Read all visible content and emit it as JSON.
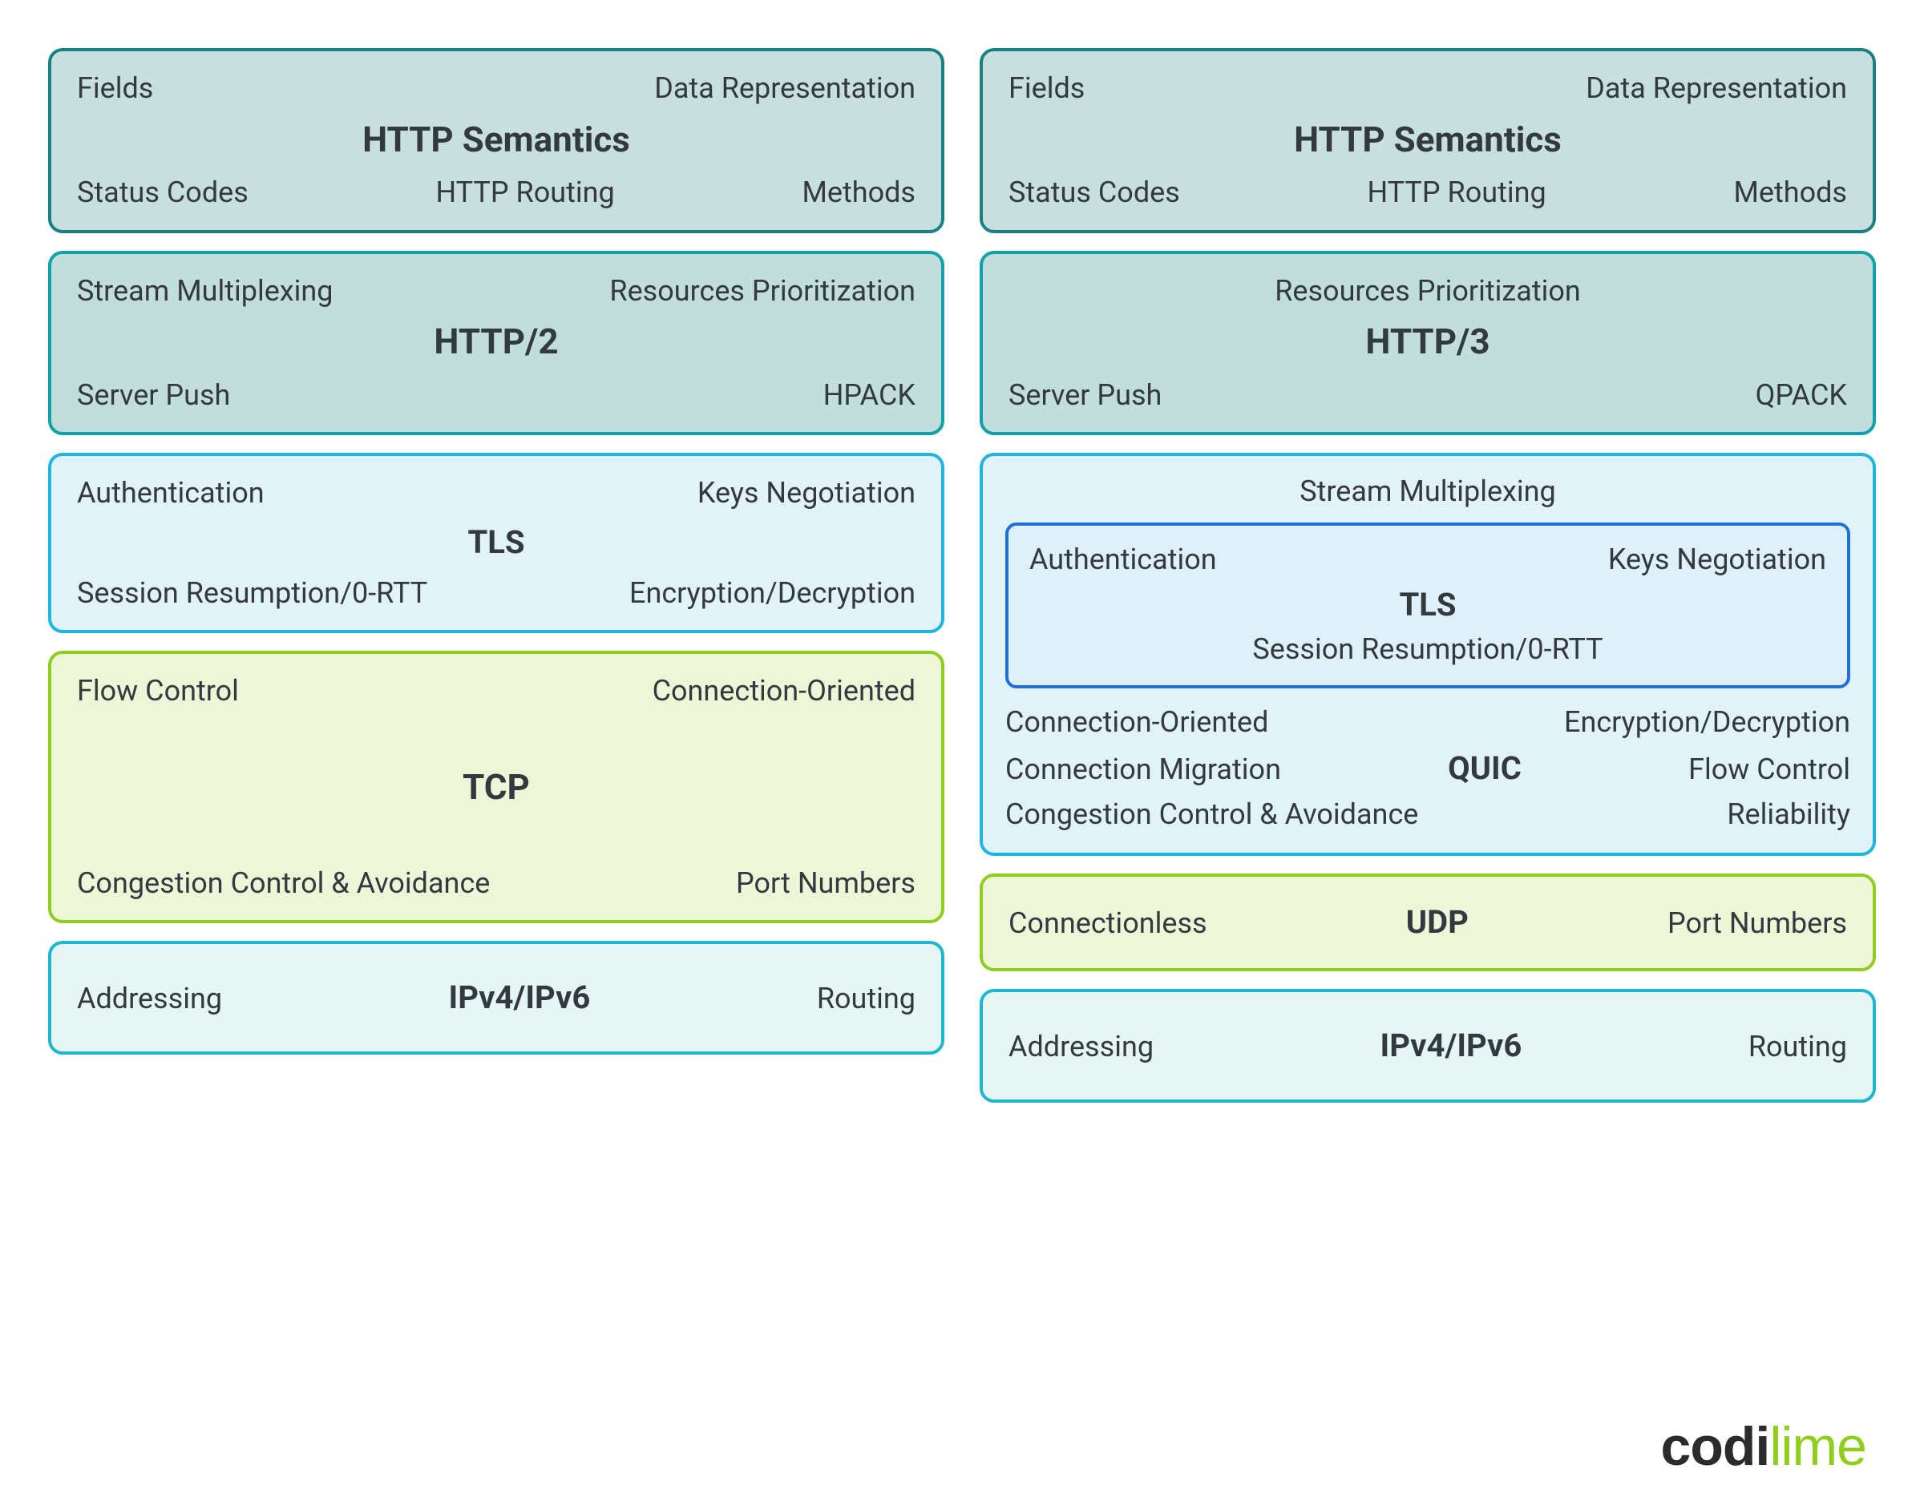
{
  "left": {
    "semantics": {
      "fields": "Fields",
      "data_rep": "Data Representation",
      "title": "HTTP Semantics",
      "status": "Status Codes",
      "routing": "HTTP Routing",
      "methods": "Methods"
    },
    "http2": {
      "stream_mux": "Stream Multiplexing",
      "res_prio": "Resources Prioritization",
      "title": "HTTP/2",
      "server_push": "Server Push",
      "hpack": "HPACK"
    },
    "tls": {
      "auth": "Authentication",
      "keys": "Keys Negotiation",
      "title": "TLS",
      "resume": "Session Resumption/0-RTT",
      "encdec": "Encryption/Decryption"
    },
    "tcp": {
      "flow": "Flow Control",
      "conn": "Connection-Oriented",
      "title": "TCP",
      "cong": "Congestion Control & Avoidance",
      "ports": "Port Numbers"
    },
    "ip": {
      "addr": "Addressing",
      "title": "IPv4/IPv6",
      "routing": "Routing"
    }
  },
  "right": {
    "semantics": {
      "fields": "Fields",
      "data_rep": "Data Representation",
      "title": "HTTP Semantics",
      "status": "Status Codes",
      "routing": "HTTP Routing",
      "methods": "Methods"
    },
    "http3": {
      "res_prio": "Resources Prioritization",
      "title": "HTTP/3",
      "server_push": "Server Push",
      "qpack": "QPACK"
    },
    "quic": {
      "stream_mux": "Stream Multiplexing",
      "tls": {
        "auth": "Authentication",
        "keys": "Keys Negotiation",
        "title": "TLS",
        "resume": "Session Resumption/0-RTT"
      },
      "conn": "Connection-Oriented",
      "encdec": "Encryption/Decryption",
      "migration": "Connection Migration",
      "title": "QUIC",
      "flow": "Flow Control",
      "cong": "Congestion Control & Avoidance",
      "reliability": "Reliability"
    },
    "udp": {
      "connless": "Connectionless",
      "title": "UDP",
      "ports": "Port Numbers"
    },
    "ip": {
      "addr": "Addressing",
      "title": "IPv4/IPv6",
      "routing": "Routing"
    }
  },
  "logo": {
    "a": "codi",
    "b": "lime"
  }
}
